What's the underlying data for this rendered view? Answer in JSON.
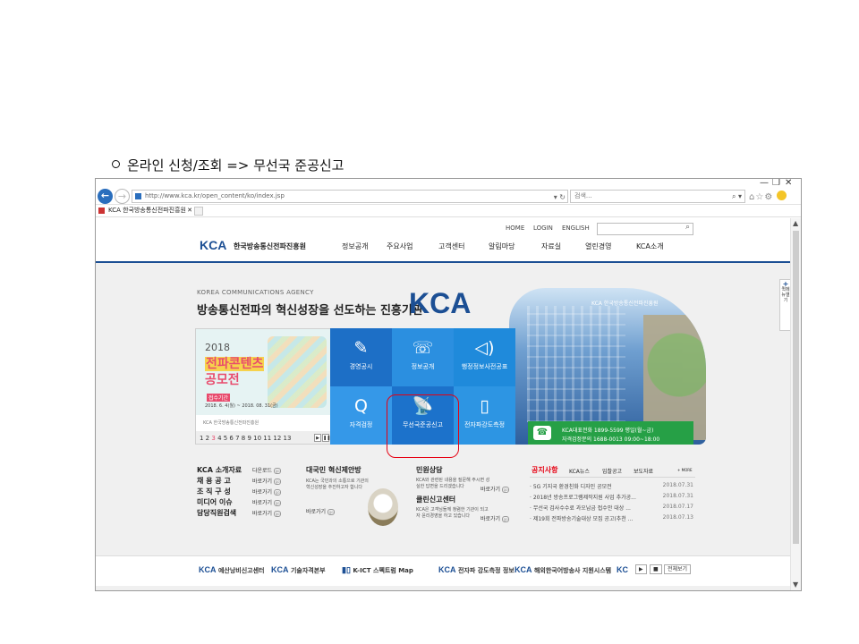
{
  "caption": "온라인 신청/조회 => 무선국 준공신고",
  "browser": {
    "window_controls": [
      "—",
      "❐",
      "✕"
    ],
    "url": "http://www.kca.kr/open_content/ko/index.jsp",
    "url_tools": "▾ ↻",
    "search_placeholder": "검색...",
    "search_go": "⌕ ▾",
    "toolbar_icons": "⌂☆⚙",
    "tab_title": "KCA 한국방송통신전파진흥원",
    "tab_close": "✕"
  },
  "header": {
    "util_links": [
      "HOME",
      "LOGIN",
      "ENGLISH"
    ],
    "search_icon": "⌕",
    "logo_mark": "KCA",
    "logo_text": "한국방송통신전파진흥원",
    "gnb": [
      "정보공개",
      "주요사업",
      "고객센터",
      "알림마당",
      "자료실",
      "열린경영",
      "KCA소개"
    ]
  },
  "hero": {
    "en": "KOREA COMMUNICATIONS AGENCY",
    "kr": "방송통신전파의 혁신성장을 선도하는 진흥기관",
    "kca": "KCA",
    "building_sign": "KCA 한국방송통신전파진흥원"
  },
  "promo": {
    "year": "2018",
    "title_line1": "전파콘텐츠",
    "title_line2": "공모전",
    "tag": "접수기간",
    "date": "2018. 6. 4(월) ~ 2018. 08. 31(금)",
    "logos": "KCA 한국방송통신전파진흥원",
    "pager_nums": "1 2",
    "pager_current": "3",
    "pager_rest": "4 5 6 7 8 9 10 11 12 13",
    "ctl_next": "▶",
    "ctl_pause": "❚❚"
  },
  "tiles": [
    {
      "label": "경영공시",
      "icon": "✎"
    },
    {
      "label": "정보공개",
      "icon": "☏"
    },
    {
      "label": "행정정보사전공표",
      "icon": "◁)"
    },
    {
      "label": "자격검정",
      "icon": "Q"
    },
    {
      "label": "무선국준공신고",
      "icon": "📡"
    },
    {
      "label": "전자파강도측정",
      "icon": "▯"
    }
  ],
  "callbar": {
    "phone_icon": "☎",
    "row1": "KCA대표전화   1899-5599        평일(월~금)",
    "row2": "자격검정문의   1688-0013        09:00~18:00"
  },
  "links": [
    {
      "label": "KCA 소개자료",
      "action": "다운로드"
    },
    {
      "label": "채 용 공 고",
      "action": "바로가기"
    },
    {
      "label": "조 직 구 성",
      "action": "바로가기"
    },
    {
      "label": "미디어 이슈",
      "action": "바로가기"
    },
    {
      "label": "담당직원검색",
      "action": "바로가기"
    }
  ],
  "go_badge": "go",
  "proposal": {
    "title": "대국민 혁신제안방",
    "desc": "KCA는 국민과의 소통으로 기관의 혁신성장을 추진하고자 합니다",
    "action": "바로가기"
  },
  "civil": {
    "title": "민원상담",
    "desc": "KCA와 관련된 내용을 질문해 주시면 성실한 답변을 드리겠습니다",
    "action": "바로가기",
    "title2": "클린신고센터",
    "desc2": "KCA은 고객님들께 청렴한 기관이 되고자 윤리경영을 하고 있습니다",
    "action2": "바로가기"
  },
  "notices": {
    "tabs": [
      "공지사항",
      "KCA뉴스",
      "입찰공고",
      "보도자료"
    ],
    "more": "+ MORE",
    "items": [
      {
        "title": "· 5G 기지국 환경친화 디자인 공모전",
        "date": "2018.07.31"
      },
      {
        "title": "· 2018년 방송프로그램제작지원 사업 추가공...",
        "date": "2018.07.31"
      },
      {
        "title": "· 무선국 검사수수료 과오납금 접수안 대상 ...",
        "date": "2018.07.17"
      },
      {
        "title": "· 제19회 전파방송기술대상 모집 공고(추천 ...",
        "date": "2018.07.13"
      }
    ]
  },
  "footer": {
    "items": [
      {
        "k": "KCA",
        "s": "예산낭비신고센터"
      },
      {
        "k": "KCA",
        "s": "기술자격본부"
      },
      {
        "k": "▮▯",
        "s": "K-ICT 스펙트럼 Map"
      },
      {
        "k": "KCA",
        "s": "전자파 강도측정 정보"
      },
      {
        "k": "KCA",
        "s": "해외한국어방송사 지원시스템"
      },
      {
        "k": "KC",
        "s": ""
      }
    ],
    "next": "▶",
    "stop": "■",
    "viewall": "전체보기"
  },
  "quickmenu": {
    "plus": "+",
    "label": "퀵메뉴열기"
  },
  "scroll": {
    "up": "▲",
    "down": "▼"
  }
}
